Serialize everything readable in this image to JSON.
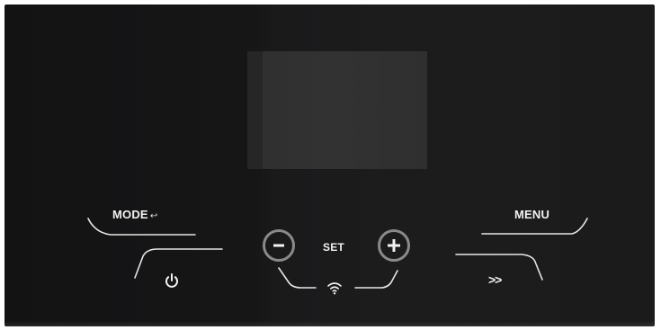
{
  "controls": {
    "mode_label": "MODE",
    "mode_return_glyph": "↩",
    "menu_label": "MENU",
    "set_label": "SET",
    "forward_label": ">>",
    "minus_glyph": "−",
    "plus_glyph": "+"
  },
  "icons": {
    "power": "power-icon",
    "wifi": "wifi-icon",
    "mode_return": "return-arrow-icon",
    "minus": "minus-icon",
    "plus": "plus-icon"
  },
  "colors": {
    "panel": "#161617",
    "display": "#303031",
    "label": "#f2f2f2",
    "ring": "#8a8a88"
  }
}
